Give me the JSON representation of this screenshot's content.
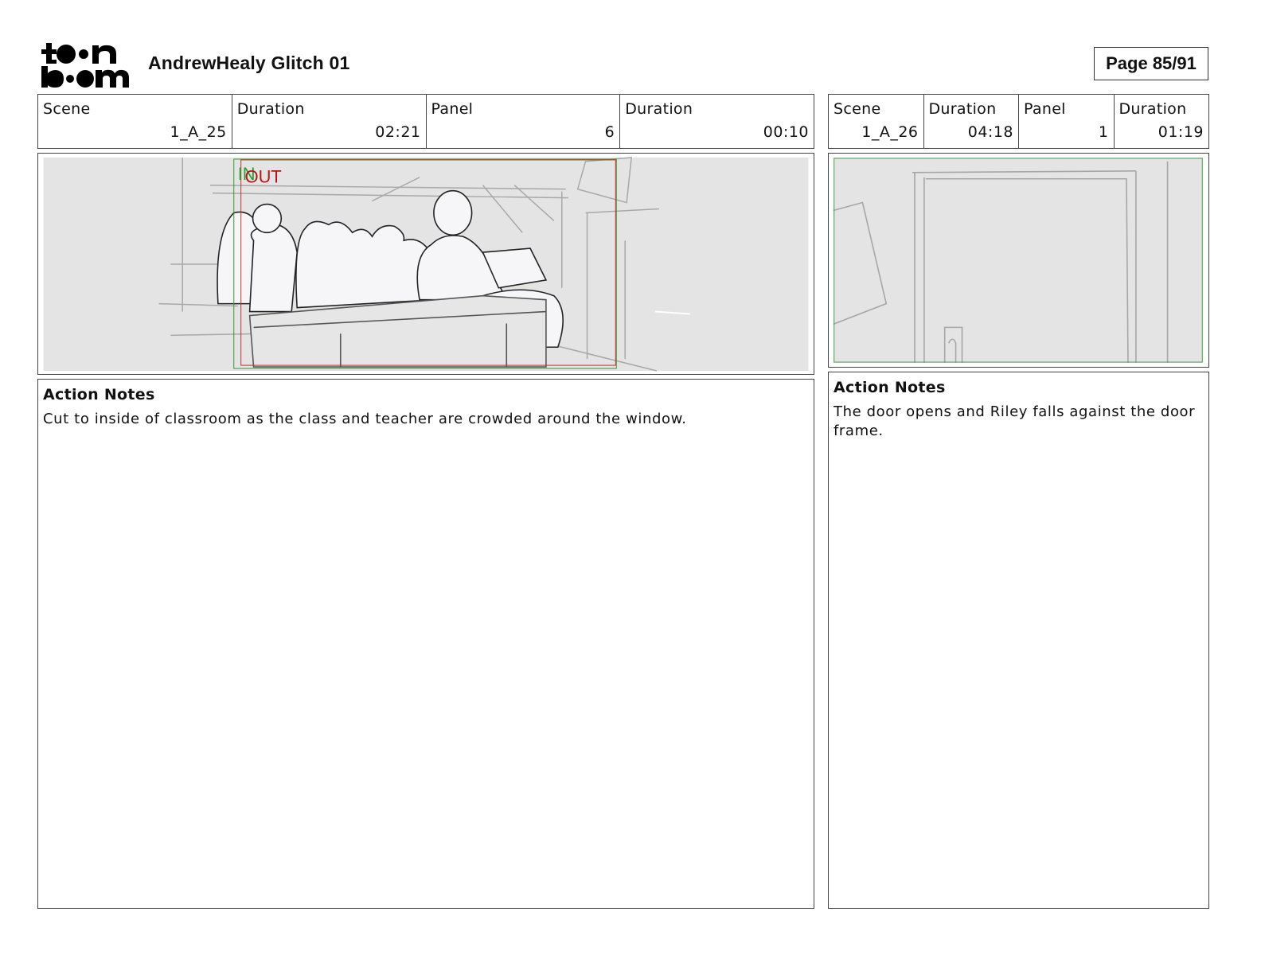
{
  "header": {
    "logo_text": "toon boom",
    "title": "AndrewHealy Glitch 01",
    "page": "Page 85/91"
  },
  "left": {
    "fields": [
      {
        "label": "Scene",
        "value": "1_A_25"
      },
      {
        "label": "Duration",
        "value": "02:21"
      },
      {
        "label": "Panel",
        "value": "6"
      },
      {
        "label": "Duration",
        "value": "00:10"
      }
    ],
    "frame_markers": {
      "in": "IN",
      "out": "OUT",
      "in_color": "#2e9e2e",
      "out_color": "#b01818"
    },
    "notes_heading": "Action Notes",
    "notes_text": "Cut to inside of classroom as the class and teacher are crowded around the window."
  },
  "right": {
    "fields": [
      {
        "label": "Scene",
        "value": "1_A_26"
      },
      {
        "label": "Duration",
        "value": "04:18"
      },
      {
        "label": "Panel",
        "value": "1"
      },
      {
        "label": "Duration",
        "value": "01:19"
      }
    ],
    "notes_heading": "Action Notes",
    "notes_text": "The door opens and Riley falls against the door frame."
  }
}
